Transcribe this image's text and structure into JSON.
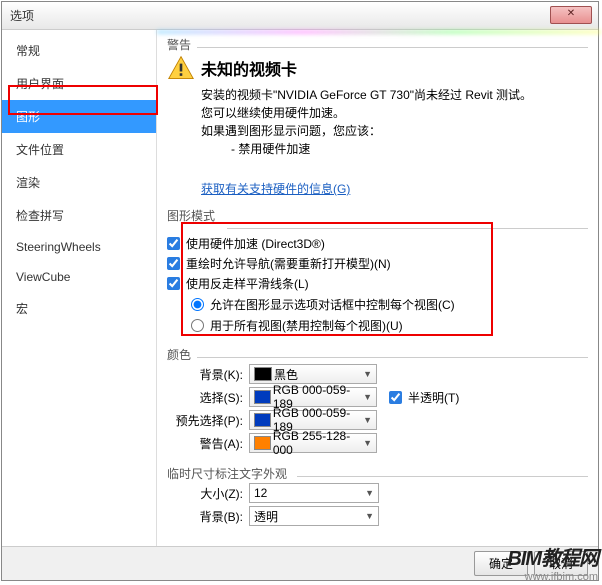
{
  "title": "选项",
  "sidebar": {
    "items": [
      {
        "label": "常规"
      },
      {
        "label": "用户界面"
      },
      {
        "label": "图形"
      },
      {
        "label": "文件位置"
      },
      {
        "label": "渲染"
      },
      {
        "label": "检查拼写"
      },
      {
        "label": "SteeringWheels"
      },
      {
        "label": "ViewCube"
      },
      {
        "label": "宏"
      }
    ]
  },
  "warning": {
    "group": "警告",
    "title": "未知的视频卡",
    "line1": "安装的视频卡\"NVIDIA GeForce GT 730\"尚未经过 Revit 测试。",
    "line2": "您可以继续使用硬件加速。",
    "line3": "如果遇到图形显示问题，您应该：",
    "line4": "- 禁用硬件加速",
    "link": "获取有关支持硬件的信息(G)"
  },
  "graphics_mode": {
    "group": "图形模式",
    "opt1": "使用硬件加速 (Direct3D®)",
    "opt2": "重绘时允许导航(需要重新打开模型)(N)",
    "opt3": "使用反走样平滑线条(L)",
    "radio1": "允许在图形显示选项对话框中控制每个视图(C)",
    "radio2": "用于所有视图(禁用控制每个视图)(U)"
  },
  "colors": {
    "group": "颜色",
    "bg_label": "背景(K):",
    "bg_value": "黑色",
    "bg_hex": "#000000",
    "sel_label": "选择(S):",
    "sel_value": "RGB 000-059-189",
    "sel_hex": "#003bbd",
    "semi": "半透明(T)",
    "pre_label": "预先选择(P):",
    "pre_value": "RGB 000-059-189",
    "pre_hex": "#003bbd",
    "warn_label": "警告(A):",
    "warn_value": "RGB 255-128-000",
    "warn_hex": "#ff8000"
  },
  "temp_size": {
    "group": "临时尺寸标注文字外观",
    "size_label": "大小(Z):",
    "size_value": "12",
    "bg_label": "背景(B):",
    "bg_value": "透明"
  },
  "footer": {
    "ok": "确定",
    "cancel": "取消"
  },
  "watermark": {
    "brand": "BIM教程网",
    "url": "www.ifbim.com"
  }
}
